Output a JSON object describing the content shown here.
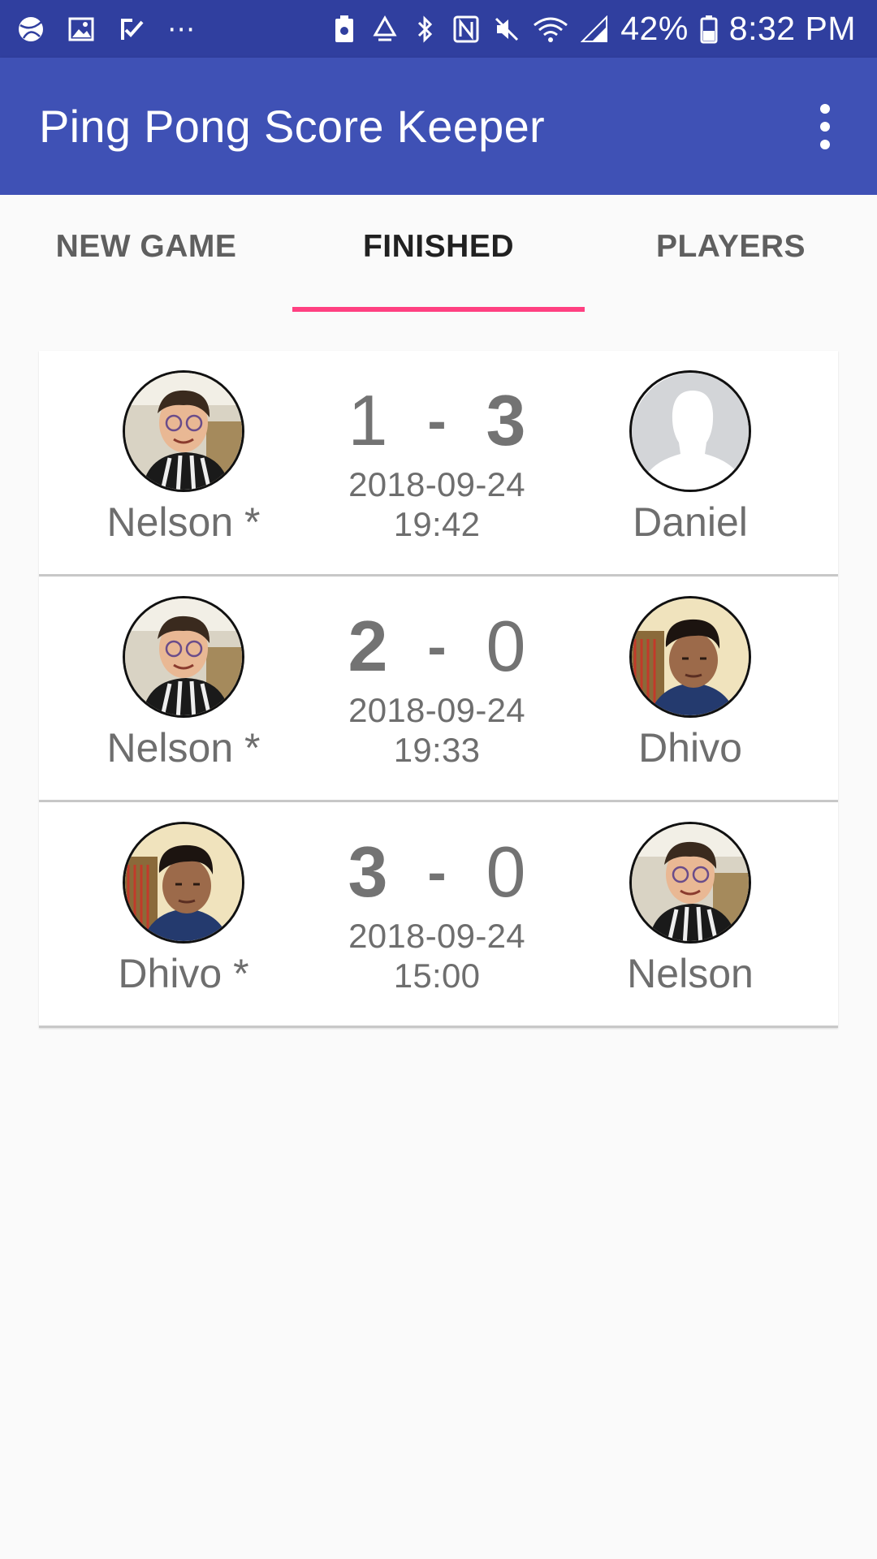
{
  "status_bar": {
    "battery_percent": "42%",
    "time": "8:32 PM",
    "left_icons": [
      "sports-ball-icon",
      "image-icon",
      "task-check-icon",
      "more-notifications-icon"
    ],
    "right_icons": [
      "battery-saver-icon",
      "recycle-icon",
      "bluetooth-icon",
      "nfc-icon",
      "mute-icon",
      "wifi-icon",
      "cell-signal-icon",
      "battery-icon"
    ]
  },
  "app_bar": {
    "title": "Ping Pong Score Keeper",
    "menu_icon": "more-vert-icon",
    "color": "#3f51b5",
    "status_color": "#303f9f"
  },
  "tabs": [
    {
      "label": "NEW GAME",
      "active": false
    },
    {
      "label": "FINISHED",
      "active": true
    },
    {
      "label": "PLAYERS",
      "active": false
    }
  ],
  "accent_color": "#ff4081",
  "matches": [
    {
      "left": {
        "name": "Nelson *",
        "avatar": "nelson-photo"
      },
      "right": {
        "name": "Daniel",
        "avatar": "default-avatar"
      },
      "score_left": "1",
      "score_right": "3",
      "separator": "-",
      "date": "2018-09-24",
      "time": "19:42",
      "winner": "right"
    },
    {
      "left": {
        "name": "Nelson *",
        "avatar": "nelson-photo"
      },
      "right": {
        "name": "Dhivo",
        "avatar": "dhivo-photo"
      },
      "score_left": "2",
      "score_right": "0",
      "separator": "-",
      "date": "2018-09-24",
      "time": "19:33",
      "winner": "left"
    },
    {
      "left": {
        "name": "Dhivo *",
        "avatar": "dhivo-photo"
      },
      "right": {
        "name": "Nelson",
        "avatar": "nelson-photo"
      },
      "score_left": "3",
      "score_right": "0",
      "separator": "-",
      "date": "2018-09-24",
      "time": "15:00",
      "winner": "left"
    }
  ]
}
